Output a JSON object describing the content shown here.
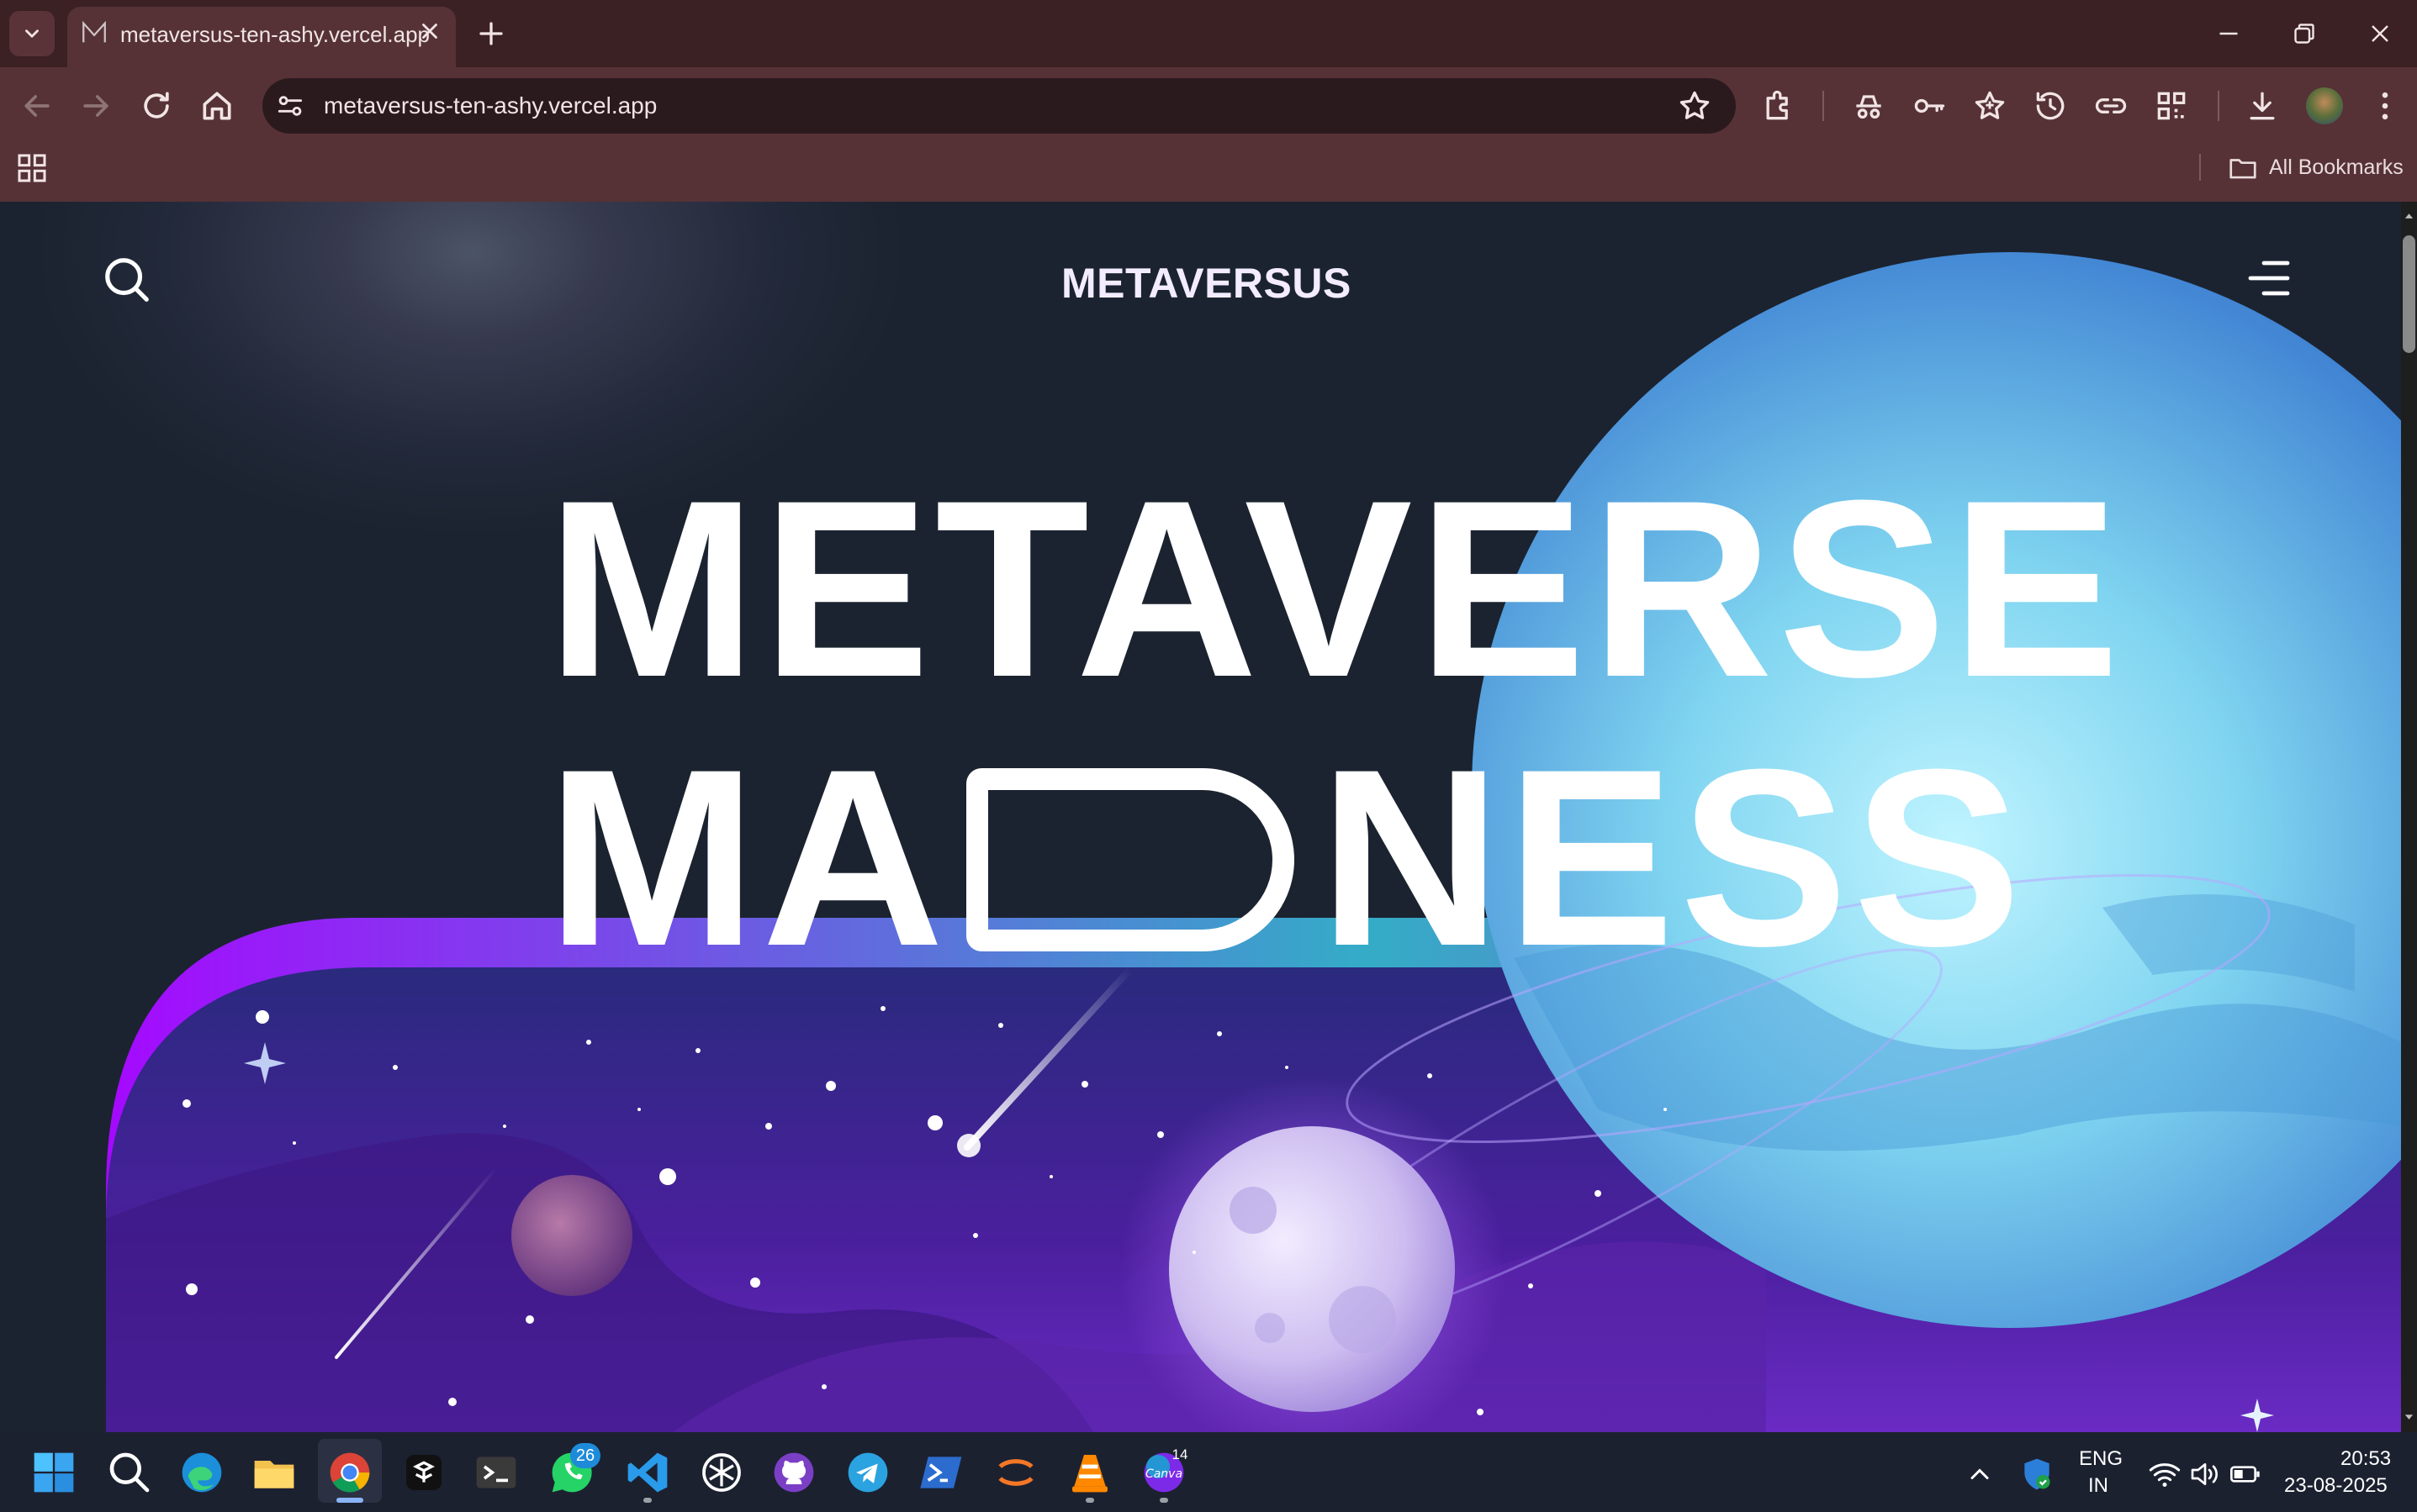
{
  "browser": {
    "tab_title": "metaversus-ten-ashy.vercel.app",
    "url": "metaversus-ten-ashy.vercel.app",
    "bookmarks_label": "All Bookmarks"
  },
  "site": {
    "brand": "METAVERSUS",
    "hero_line1": "METAVERSE",
    "hero_line2_part1": "MA",
    "hero_line2_part2": "NESS",
    "colors": {
      "accent_purple": "#a509ff",
      "accent_cyan": "#34acc7",
      "background": "#1a232e"
    }
  },
  "taskbar": {
    "whatsapp_badge": "26",
    "canva_badge": "14",
    "lang_line1": "ENG",
    "lang_line2": "IN",
    "time": "20:53",
    "date": "23-08-2025"
  }
}
